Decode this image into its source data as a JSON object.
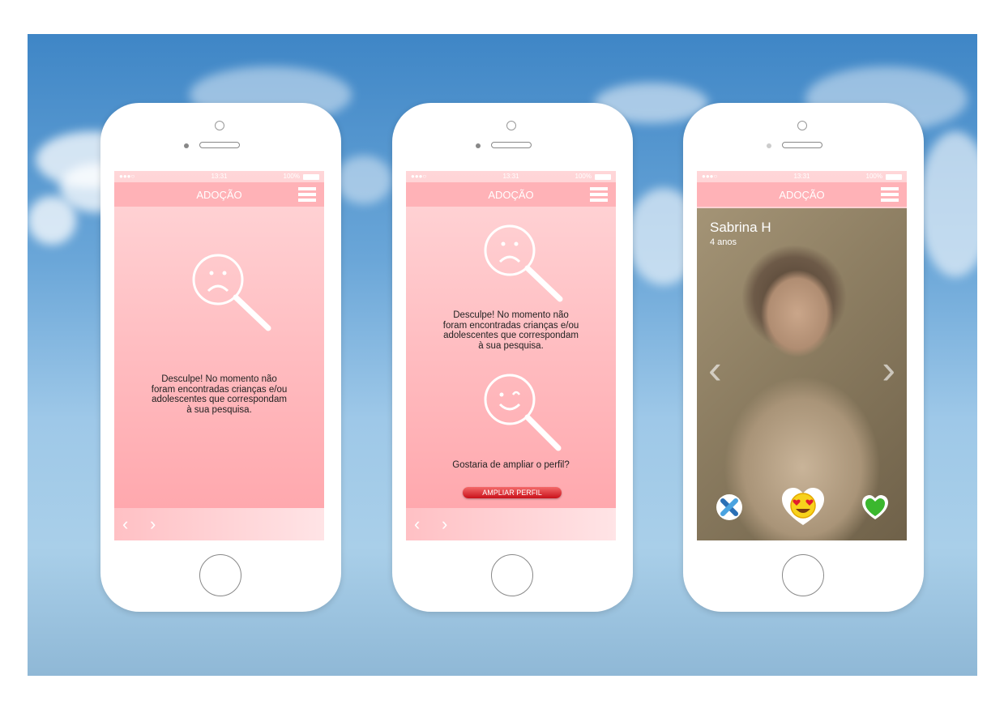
{
  "phones": [
    {
      "status": {
        "time": "13:31",
        "battery": "100%"
      },
      "title": "ADOÇÃO",
      "message": [
        "Desculpe! No momento não",
        "foram encontradas crianças e/ou",
        "adolescentes que correspondam",
        "à sua pesquisa."
      ]
    },
    {
      "status": {
        "time": "13:31",
        "battery": "100%"
      },
      "title": "ADOÇÃO",
      "message": [
        "Desculpe! No momento não",
        "foram encontradas crianças e/ou",
        "adolescentes que correspondam",
        "à sua pesquisa."
      ],
      "question": "Gostaria de ampliar o perfil?",
      "button": "AMPLIAR PERFIL"
    },
    {
      "status": {
        "time": "13:31",
        "battery": "100%"
      },
      "title": "ADOÇÃO",
      "profile": {
        "name": "Sabrina H",
        "age": "4 anos"
      }
    }
  ],
  "icons": {
    "nav_back": "chevron-left-icon",
    "nav_forward": "chevron-right-icon",
    "menu": "hamburger-menu-icon",
    "search_sad": "magnifier-sad-face-icon",
    "search_wink": "magnifier-wink-face-icon",
    "reject": "x-icon",
    "love": "heart-eyes-emoji-icon",
    "like": "green-heart-icon"
  },
  "colors": {
    "screen_top": "#ffd6d8",
    "screen_bottom": "#ffa4aa",
    "button": "#d41c24"
  }
}
